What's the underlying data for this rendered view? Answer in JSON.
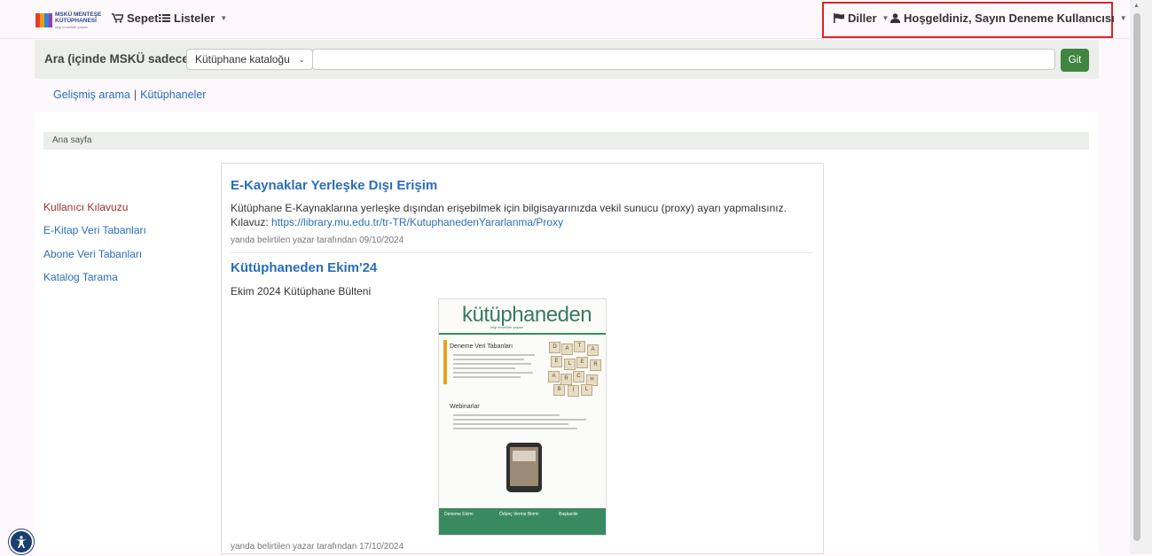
{
  "header": {
    "logo": {
      "line1": "MSKÜ MENTEŞE",
      "line2": "KÜTÜPHANESİ",
      "tagline": "bilgi temellidir yaşam",
      "colors": [
        "#e63a2e",
        "#f39c12",
        "#2e86de",
        "#8e44ad"
      ]
    },
    "cart_label": "Sepet",
    "lists_label": "Listeler",
    "languages_label": "Diller",
    "user_label": "Hoşgeldiniz, Sayın Deneme Kullanıcısı",
    "highlight_color": "#d9242c"
  },
  "search": {
    "label": "Ara (içinde MSKÜ sadece)",
    "scope_selected": "Kütüphane kataloğu",
    "query_value": "",
    "query_placeholder": "",
    "go_label": "Git",
    "go_color": "#408540"
  },
  "subnav": {
    "advanced_search": "Gelişmiş arama",
    "separator": "|",
    "libraries": "Kütüphaneler"
  },
  "breadcrumb": {
    "home": "Ana sayfa"
  },
  "sidebar": {
    "items": [
      {
        "label": "Kullanıcı Kılavuzu",
        "active": true
      },
      {
        "label": "E-Kitap Veri Tabanları",
        "active": false
      },
      {
        "label": "Abone Veri Tabanları",
        "active": false
      },
      {
        "label": "Katalog Tarama",
        "active": false
      }
    ]
  },
  "news": [
    {
      "title": "E-Kaynaklar Yerleşke Dışı Erişim",
      "body_line1": "Kütüphane E-Kaynaklarına yerleşke dışından erişebilmek için bilgisayarınızda vekil sunucu (proxy) ayarı yapmalısınız.",
      "body_line2_prefix": "Kılavuz: ",
      "link": "https://library.mu.edu.tr/tr-TR/KutuphanedenYararlanma/Proxy",
      "meta": "yanda belirtilen yazar tarafından 09/10/2024"
    },
    {
      "title": "Kütüphaneden Ekim'24",
      "body": "Ekim 2024 Kütüphane Bülteni",
      "meta": "yanda belirtilen yazar tarafından 17/10/2024",
      "cover": {
        "heading": "kütüphaneden",
        "subheading": "bilgi temellidir yaşam",
        "section1": "Deneme Veri Tabanları",
        "section2": "Webinarlar",
        "footer1": "Deneme Ekimi",
        "footer2": "Ödünç Verme Birimi",
        "footer3": "Başkanlık",
        "accent_color": "#3a8a60"
      }
    }
  ],
  "icons": {
    "cart": "cart-icon",
    "lists": "list-icon",
    "languages": "flag-icon",
    "user": "user-icon",
    "accessibility": "accessibility-icon"
  }
}
